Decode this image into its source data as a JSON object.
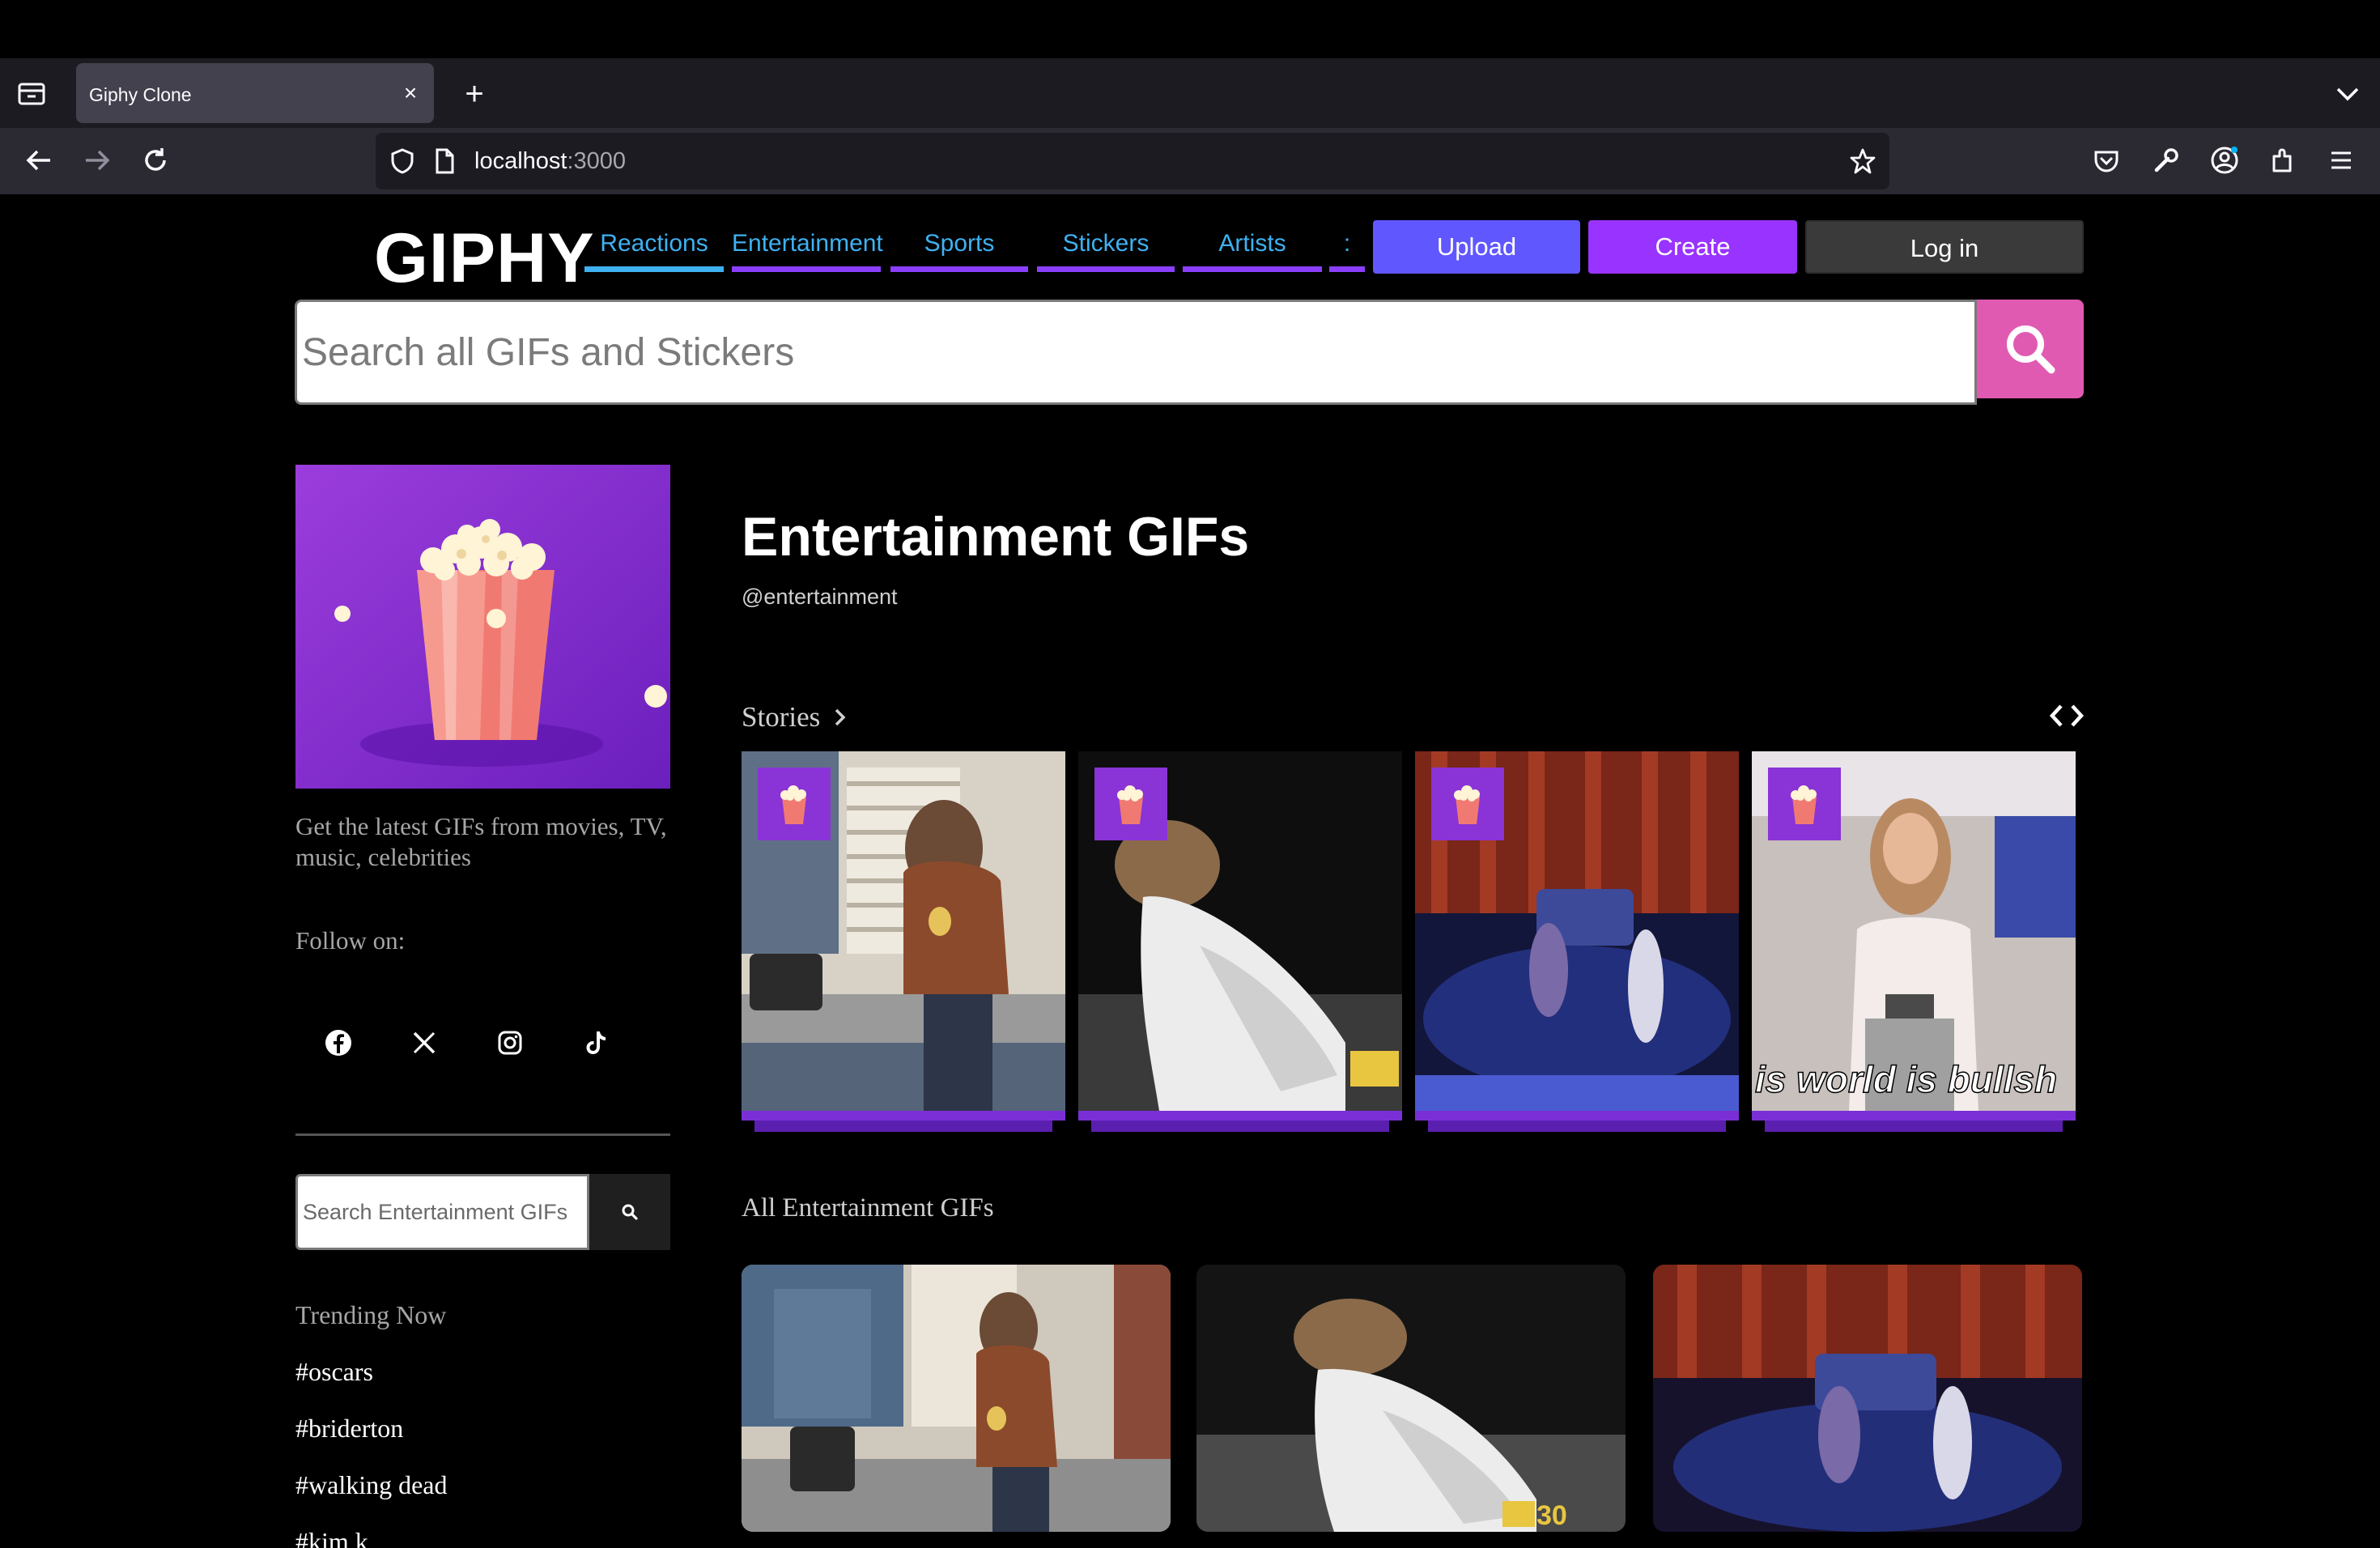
{
  "browser": {
    "tab_title": "Giphy Clone",
    "url_host": "localhost",
    "url_port": ":3000"
  },
  "header": {
    "logo": "GIPHY",
    "nav": [
      {
        "label": "Reactions",
        "color": "#3fb1f1"
      },
      {
        "label": "Entertainment",
        "color": "#8a3ffc"
      },
      {
        "label": "Sports",
        "color": "#8a3ffc"
      },
      {
        "label": "Stickers",
        "color": "#8a3ffc"
      },
      {
        "label": "Artists",
        "color": "#8a3ffc"
      },
      {
        "label": ":",
        "color": "#8a3ffc"
      }
    ],
    "upload_label": "Upload",
    "create_label": "Create",
    "login_label": "Log in",
    "colors": {
      "upload": "#6157ff",
      "create": "#9933ff",
      "login": "#3a3a3a",
      "search_btn": "#e05ab2"
    }
  },
  "search": {
    "placeholder": "Search all GIFs and Stickers"
  },
  "sidebar": {
    "description": "Get the latest GIFs from movies, TV, music, celebrities",
    "follow_label": "Follow on:",
    "social_icons": [
      "facebook-icon",
      "x-icon",
      "instagram-icon",
      "tiktok-icon"
    ],
    "search_placeholder": "Search Entertainment GIFs",
    "trending_title": "Trending Now",
    "trending_tags": [
      "#oscars",
      "#briderton",
      "#walking dead",
      "#kim k"
    ]
  },
  "main": {
    "title": "Entertainment GIFs",
    "handle": "@entertainment",
    "stories_title": "Stories",
    "stories": [
      {
        "scene": "kitchen",
        "caption": ""
      },
      {
        "scene": "stage-white-dress",
        "caption": ""
      },
      {
        "scene": "stage-band",
        "caption": ""
      },
      {
        "scene": "award-speech",
        "caption": "is world is bullsh"
      }
    ],
    "all_title": "All Entertainment GIFs",
    "grid": [
      {
        "scene": "kitchen"
      },
      {
        "scene": "stage-white-dress"
      },
      {
        "scene": "stage-band"
      }
    ]
  }
}
